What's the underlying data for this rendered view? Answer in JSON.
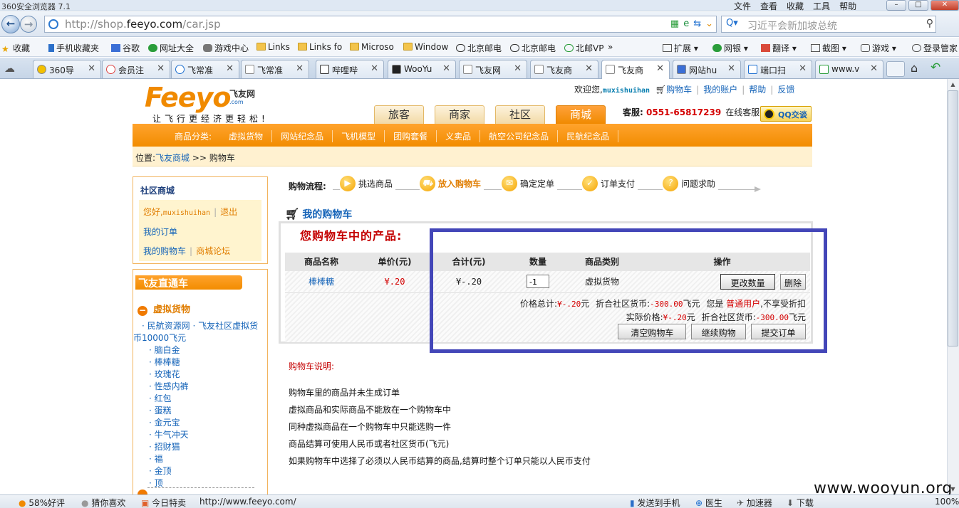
{
  "browser": {
    "title": "360安全浏览器 7.1",
    "menus": [
      "文件",
      "查看",
      "收藏",
      "工具",
      "帮助"
    ],
    "url_prefix": "http://shop.",
    "url_domain": "feeyo.com",
    "url_path": "/car.jsp",
    "search_placeholder": "习近平会新加坡总统",
    "favorites": [
      {
        "label": "收藏"
      },
      {
        "label": "手机收藏夹"
      },
      {
        "label": "谷歌"
      },
      {
        "label": "网址大全"
      },
      {
        "label": "游戏中心"
      },
      {
        "label": "Links"
      },
      {
        "label": "Links fo"
      },
      {
        "label": "Microso"
      },
      {
        "label": "Window"
      },
      {
        "label": "北京邮电"
      },
      {
        "label": "北京邮电"
      },
      {
        "label": "北邮VP"
      }
    ],
    "fav_more": "»",
    "fav_right": [
      {
        "label": "扩展"
      },
      {
        "label": "网银"
      },
      {
        "label": "翻译"
      },
      {
        "label": "截图"
      },
      {
        "label": "游戏"
      },
      {
        "label": "登录管家"
      }
    ],
    "tabs": [
      {
        "label": "360导"
      },
      {
        "label": "会员注"
      },
      {
        "label": "飞常准"
      },
      {
        "label": "飞常准"
      },
      {
        "label": "哔哩哔"
      },
      {
        "label": "WooYu"
      },
      {
        "label": "飞友网"
      },
      {
        "label": "飞友商"
      },
      {
        "label": "飞友商"
      },
      {
        "label": "网站hu"
      },
      {
        "label": "端口扫"
      },
      {
        "label": "www.v"
      }
    ]
  },
  "header": {
    "logo_text": "Feeyo",
    "logo_cn": "飞友网",
    "logo_com": ".com",
    "slogan": "让飞行更经济更轻松!",
    "welcome": "欢迎您,",
    "username": "muxishuihan",
    "cart_link": "购物车",
    "account_link": "我的账户",
    "help_link": "帮助",
    "feedback_link": "反馈",
    "sep": "|",
    "hotline_label": "客服:",
    "hotline_num": "0551-65817239",
    "online_service": "在线客服",
    "qq_button": "QQ交谈",
    "main_tabs": [
      {
        "label": "旅客"
      },
      {
        "label": "商家"
      },
      {
        "label": "社区"
      },
      {
        "label": "商城"
      }
    ]
  },
  "category_bar": {
    "items": [
      "商品分类:",
      "虚拟货物",
      "网站纪念品",
      "飞机模型",
      "团购套餐",
      "义卖品",
      "航空公司纪念品",
      "民航纪念品"
    ]
  },
  "breadcrumb": {
    "label": "位置:",
    "home": "飞友商城",
    "arrow": ">>",
    "current": "购物车"
  },
  "sidebar": {
    "title": "社区商城",
    "greeting": "您好,",
    "username": "muxishuihan",
    "logout": "退出",
    "my_orders": "我的订单",
    "my_cart": "我的购物车",
    "forum": "商城论坛",
    "sep": "|",
    "direct_title": "飞友直通车",
    "category": "虚拟货物",
    "items": [
      "· 民航资源网 · 飞友社区虚拟货",
      "币10000飞元",
      "· 脑白金",
      "· 棒棒糖",
      "· 玫瑰花",
      "· 性感内裤",
      "· 红包",
      "· 蛋糕",
      "· 金元宝",
      "· 牛气冲天",
      "· 招财猫",
      "· 福",
      "· 金顶",
      "· 顶"
    ]
  },
  "flow": {
    "label": "购物流程:",
    "steps": [
      {
        "label": "挑选商品",
        "icon": "play-icon"
      },
      {
        "label": "放入购物车",
        "icon": "cart-icon"
      },
      {
        "label": "确定定单",
        "icon": "mail-icon"
      },
      {
        "label": "订单支付",
        "icon": "check-icon"
      },
      {
        "label": "问题求助",
        "icon": "question-icon"
      }
    ]
  },
  "cart": {
    "heading": "我的购物车",
    "box_title": "您购物车中的产品:",
    "columns": [
      "商品名称",
      "单价(元)",
      "合计(元)",
      "数量",
      "商品类别",
      "操作"
    ],
    "rows": [
      {
        "name": "棒棒糖",
        "price": "¥.20",
        "total": "¥-.20",
        "qty": "-1",
        "category": "虚拟货物",
        "update_btn": "更改数量",
        "delete_btn": "删除"
      }
    ],
    "sum_label": "价格总计:",
    "sum_value": "¥-.20",
    "yuan": "元",
    "convert_label": "折合社区货币:",
    "convert_value": "-300.00",
    "feiyuan": "飞元",
    "you_are": "您是",
    "user_level": "普通用户",
    "no_discount": ",不享受折扣",
    "actual_label": "实际价格:",
    "actual_value": "¥-.20",
    "clear_btn": "清空购物车",
    "continue_btn": "继续购物",
    "submit_btn": "提交订单"
  },
  "notes": {
    "title": "购物车说明:",
    "lines": [
      "购物车里的商品并未生成订单",
      "虚拟商品和实际商品不能放在一个购物车中",
      "同种虚拟商品在一个购物车中只能选购一件",
      "商品结算可使用人民币或者社区货币(飞元)",
      "如果购物车中选择了必须以人民币结算的商品,结算时整个订单只能以人民币支付"
    ]
  },
  "statusbar": {
    "rating": "58%好评",
    "guess": "猜你喜欢",
    "today": "今日特卖",
    "hover_url": "http://www.feeyo.com/",
    "send_phone": "发送到手机",
    "doctor": "医生",
    "accelerator": "加速器",
    "download": "下载",
    "zoom": "100%"
  },
  "watermark": "www.wooyun.org",
  "colors": {
    "brand_orange": "#f28c00",
    "link_blue": "#1463b8",
    "price_red": "#d40000",
    "highlight_box": "#4346b8"
  }
}
